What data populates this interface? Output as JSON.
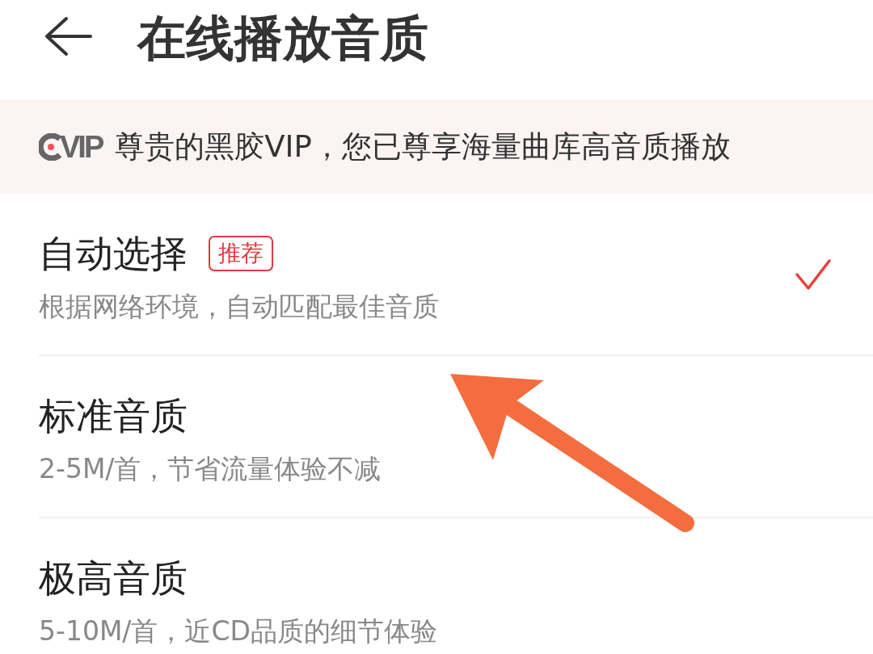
{
  "header": {
    "title": "在线播放音质"
  },
  "vip_banner": {
    "logo_text": "VIP",
    "message": "尊贵的黑胶VIP，您已尊享海量曲库高音质播放"
  },
  "options": [
    {
      "title": "自动选择",
      "badge": "推荐",
      "description": "根据网络环境，自动匹配最佳音质",
      "selected": true
    },
    {
      "title": "标准音质",
      "description": "2-5M/首，节省流量体验不减",
      "selected": false
    },
    {
      "title": "极高音质",
      "description": "5-10M/首，近CD品质的细节体验",
      "selected": false
    }
  ]
}
